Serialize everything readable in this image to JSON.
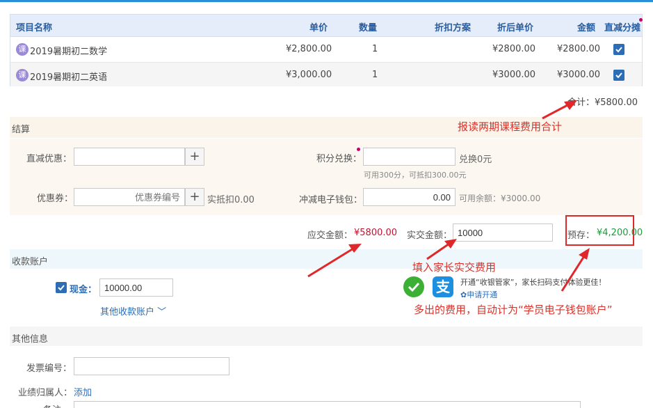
{
  "table": {
    "headers": {
      "name": "项目名称",
      "price": "单价",
      "qty": "数量",
      "discount_plan": "折扣方案",
      "discounted_price": "折后单价",
      "amount": "金额",
      "direct_split": "直减分摊"
    },
    "rows": [
      {
        "icon": "课",
        "name": "2019暑期初二数学",
        "price": "¥2,800.00",
        "qty": "1",
        "discount_plan": "",
        "discounted_price": "¥2800.00",
        "amount": "¥2800.00",
        "checked": true
      },
      {
        "icon": "课",
        "name": "2019暑期初二英语",
        "price": "¥3,000.00",
        "qty": "1",
        "discount_plan": "",
        "discounted_price": "¥3000.00",
        "amount": "¥3000.00",
        "checked": true
      }
    ]
  },
  "total_text": "合计：¥5800.00",
  "annotations": {
    "total": "报读两期课程费用合计",
    "paid": "填入家长实交费用",
    "extra": "多出的费用，自动计为“学员电子钱包账户”"
  },
  "settlement": {
    "title": "结算",
    "direct_discount_label": "直减优惠：",
    "direct_discount_value": "",
    "points_label": "积分兑换：",
    "points_value": "",
    "points_exchange": "兑换0元",
    "points_hint": "可用300分，可抵扣300.00元",
    "coupon_label": "优惠券：",
    "coupon_placeholder": "优惠券编号",
    "coupon_deduct": "实抵扣0.00",
    "wallet_label": "冲减电子钱包：",
    "wallet_value": "0.00",
    "wallet_available": "可用余额：¥3000.00"
  },
  "payment": {
    "due_label": "应交金额：",
    "due_value": "¥5800.00",
    "paid_label": "实交金额：",
    "paid_value": "10000",
    "prestore_label": "预存：",
    "prestore_value": "¥4,200.00"
  },
  "accounts": {
    "title": "收款账户",
    "cash_label": "现金：",
    "cash_value": "10000.00",
    "other_accounts": "其他收款账户",
    "promo_text": "开通“收银管家”，家长扫码支付体验更佳！",
    "apply_link": "申请开通"
  },
  "other_info": {
    "title": "其他信息",
    "invoice_label": "发票编号：",
    "invoice_value": "",
    "owner_label": "业绩归属人：",
    "owner_add": "添加",
    "remark_label": "备注"
  },
  "colors": {
    "accent": "#2d6db5",
    "header_text": "#2a5da0",
    "due_red": "#c8102e",
    "prestore_green": "#1e9b3c",
    "annotation_red": "#d8322a"
  }
}
